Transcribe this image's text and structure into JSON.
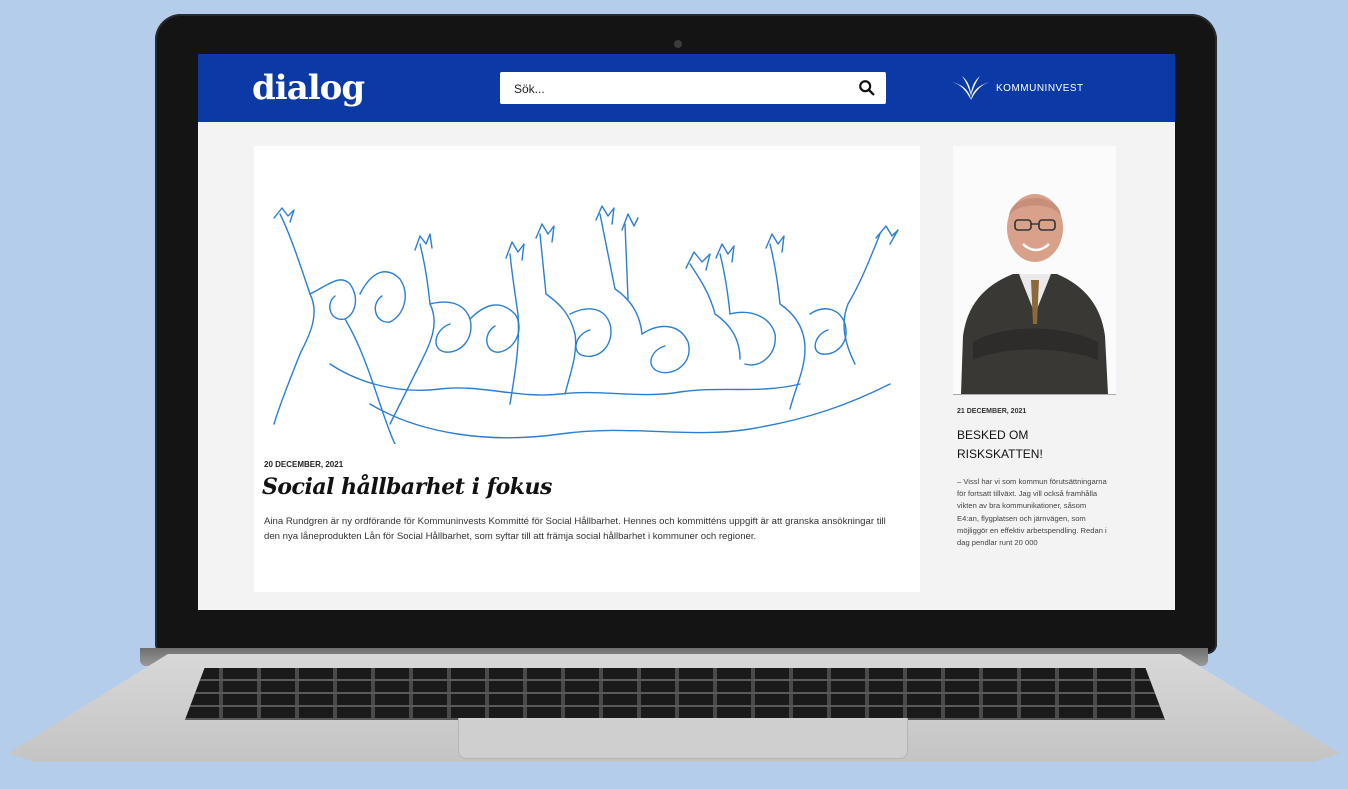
{
  "site": {
    "logo": "dialog",
    "brand_name": "KOMMUNINVEST"
  },
  "search": {
    "placeholder": "Sök..."
  },
  "article": {
    "date": "20 DECEMBER, 2021",
    "title": "Social hållbarhet i fokus",
    "body": "Aina Rundgren är ny ordförande för Kommuninvests Kommitté för Social Hållbarhet. Hennes och kommitténs uppgift är att granska ansökningar till den nya låneprodukten Lån för Social Hållbarhet, som syftar till att främja social hållbarhet i kommuner och regioner."
  },
  "side_article": {
    "date": "21 DECEMBER, 2021",
    "title": "BESKED OM RISKSKATTEN!",
    "body": "– Vissl har vi som kommun förutsättningarna för fortsatt tillväxt. Jag vill också framhålla vikten av bra kommunikationer, såsom E4:an, flygplatsen och järnvägen, som möjliggör en effektiv arbetspendling. Redan i dag pendlar runt 20 000"
  },
  "colors": {
    "header": "#0b3aa6",
    "background": "#b3cdea",
    "illustration_line": "#2a7fd0"
  }
}
